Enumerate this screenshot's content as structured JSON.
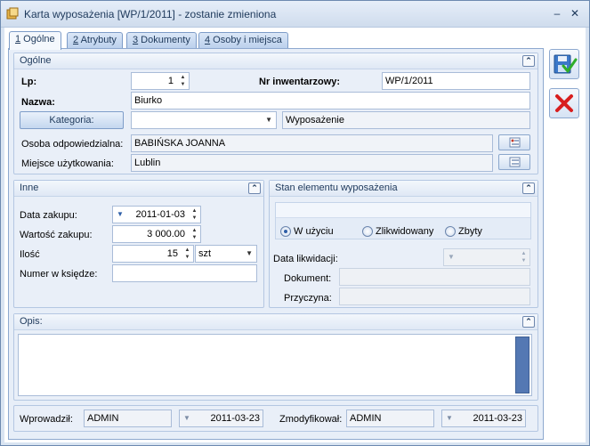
{
  "window": {
    "title": "Karta wyposażenia [WP/1/2011] - zostanie zmieniona"
  },
  "tabs": [
    {
      "num": "1",
      "label": " Ogólne"
    },
    {
      "num": "2",
      "label": " Atrybuty"
    },
    {
      "num": "3",
      "label": " Dokumenty"
    },
    {
      "num": "4",
      "label": " Osoby i miejsca"
    }
  ],
  "general": {
    "header": "Ogólne",
    "lp_label": "Lp:",
    "lp_value": "1",
    "inv_label": "Nr inwentarzowy:",
    "inv_value": "WP/1/2011",
    "name_label": "Nazwa:",
    "name_value": "Biurko",
    "category_button": "Kategoria:",
    "category_value": "",
    "category_desc": "Wyposażenie",
    "person_label": "Osoba odpowiedzialna:",
    "person_value": "BABIŃSKA JOANNA",
    "place_label": "Miejsce użytkowania:",
    "place_value": "Lublin"
  },
  "inne": {
    "header": "Inne",
    "purchase_date_label": "Data zakupu:",
    "purchase_date_value": "2011-01-03",
    "purchase_value_label": "Wartość zakupu:",
    "purchase_value_value": "3 000.00",
    "qty_label": "Ilość",
    "qty_value": "15",
    "unit_value": "szt",
    "book_label": "Numer w księdze:",
    "book_value": ""
  },
  "stan": {
    "header": "Stan elementu wyposażenia",
    "options": [
      "W użyciu",
      "Zlikwidowany",
      "Zbyty"
    ],
    "selected": "W użyciu",
    "liq_date_label": "Data likwidacji:",
    "doc_label": "Dokument:",
    "reason_label": "Przyczyna:"
  },
  "opis": {
    "header": "Opis:",
    "value": ""
  },
  "footer": {
    "entered_label": "Wprowadził:",
    "entered_by": "ADMIN",
    "entered_date": "2011-03-23",
    "modified_label": "Zmodyfikował:",
    "modified_by": "ADMIN",
    "modified_date": "2011-03-23"
  },
  "colors": {
    "save": "#2f6fc0",
    "cancel": "#d81e1e"
  }
}
